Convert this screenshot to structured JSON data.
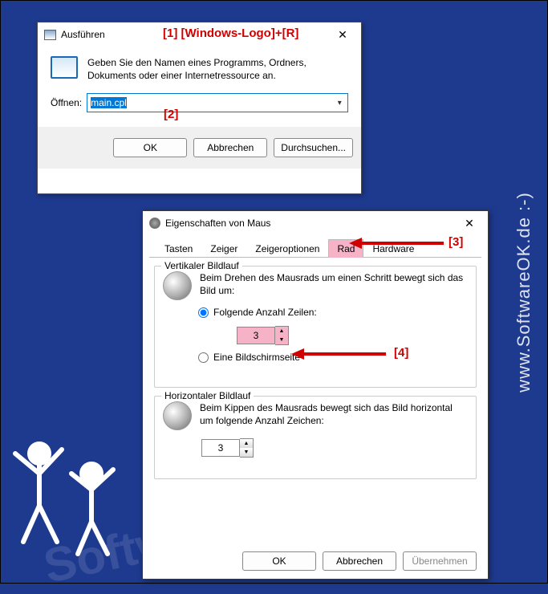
{
  "run": {
    "title": "Ausführen",
    "desc": "Geben Sie den Namen eines Programms, Ordners, Dokuments oder einer Internetressource an.",
    "open_label": "Öffnen:",
    "input_value": "main.cpl",
    "ok": "OK",
    "cancel": "Abbrechen",
    "browse": "Durchsuchen..."
  },
  "annotations": {
    "a1": "[1]  [Windows-Logo]+[R]",
    "a2": "[2]",
    "a3": "[3]",
    "a4": "[4]"
  },
  "mouse": {
    "title": "Eigenschaften von Maus",
    "tabs": {
      "t1": "Tasten",
      "t2": "Zeiger",
      "t3": "Zeigeroptionen",
      "t4": "Rad",
      "t5": "Hardware"
    },
    "vertical": {
      "legend": "Vertikaler Bildlauf",
      "desc": "Beim Drehen des Mausrads um einen Schritt bewegt sich das Bild um:",
      "radio1": "Folgende Anzahl Zeilen:",
      "lines_value": "3",
      "radio2": "Eine Bildschirmseite"
    },
    "horizontal": {
      "legend": "Horizontaler Bildlauf",
      "desc": "Beim Kippen des Mausrads bewegt sich das Bild horizontal um folgende Anzahl Zeichen:",
      "chars_value": "3"
    },
    "ok": "OK",
    "cancel": "Abbrechen",
    "apply": "Übernehmen"
  },
  "watermark": "www.SoftwareOK.de :-)",
  "watermark2": "SoftwareOK.de"
}
